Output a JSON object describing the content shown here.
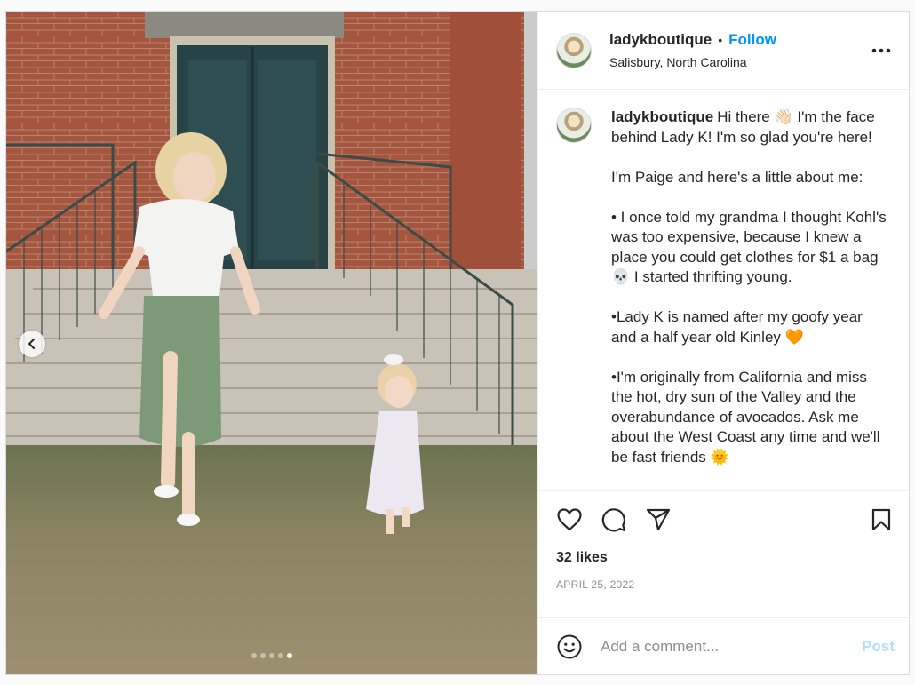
{
  "post": {
    "username": "ladykboutique",
    "follow_label": "Follow",
    "separator": "•",
    "location": "Salisbury, North Carolina",
    "caption_text": "Hi there 👋🏻 I'm the face behind Lady K! I'm so glad you're here!\n\nI'm Paige and here's a little about me:\n\n• I once told my grandma I thought Kohl's was too expensive, because I knew a place you could get clothes for $1 a bag 💀 I started thrifting young.\n\n•Lady K is named after my goofy year and a half year old Kinley 🧡\n\n•I'm originally from California and miss the hot, dry sun of the Valley and the overabundance of avocados. Ask me about the West Coast any time and we'll be fast friends 🌞",
    "likes": "32 likes",
    "date": "APRIL 25, 2022",
    "carousel": {
      "count": 5,
      "active_index": 4
    }
  },
  "comment": {
    "placeholder": "Add a comment...",
    "post_label": "Post"
  },
  "icons": {
    "prev": "chevron-left-icon",
    "more": "more-horizontal-icon",
    "like": "heart-icon",
    "comment": "comment-bubble-icon",
    "share": "paper-plane-icon",
    "save": "bookmark-icon",
    "emoji": "smiley-icon"
  },
  "colors": {
    "follow": "#0095f6",
    "post_disabled": "#b2dffc",
    "muted": "#8e8e8e"
  }
}
